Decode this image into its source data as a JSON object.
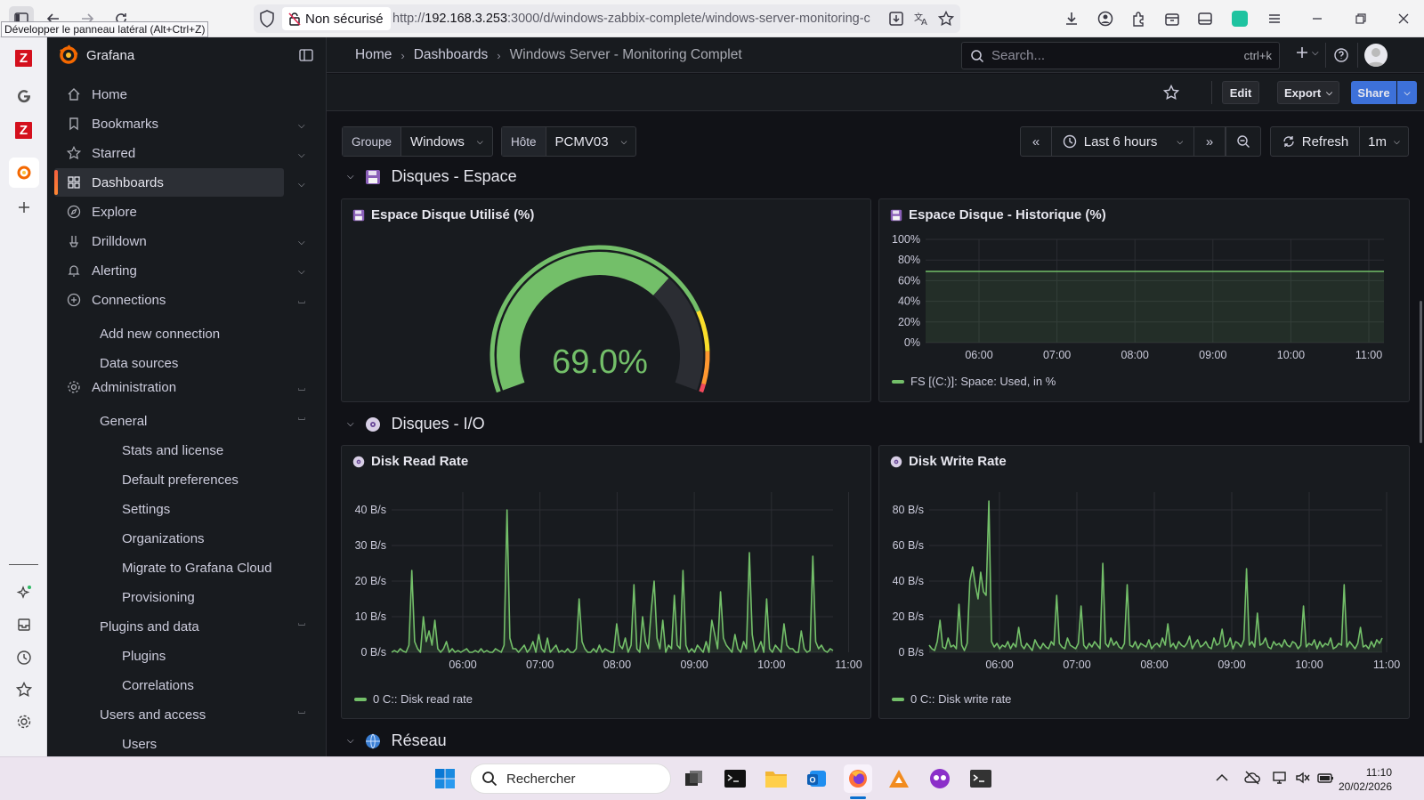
{
  "browser": {
    "tooltip": "Développer le panneau latéral (Alt+Ctrl+Z)",
    "security_label": "Non sécurisé",
    "url_prefix": "http://",
    "url_host": "192.168.3.253",
    "url_rest": ":3000/d/windows-zabbix-complete/windows-server-monitoring-c"
  },
  "appbar": {
    "items": [
      "zabbix",
      "google",
      "zabbix",
      "grafana",
      "add",
      "ai-sparkle",
      "inbox",
      "history",
      "favorites",
      "settings"
    ]
  },
  "nav": {
    "brand": "Grafana",
    "items": [
      {
        "label": "Home",
        "icon": "home-icon"
      },
      {
        "label": "Bookmarks",
        "icon": "bookmark-icon"
      },
      {
        "label": "Starred",
        "icon": "star-icon"
      },
      {
        "label": "Dashboards",
        "icon": "apps-icon"
      },
      {
        "label": "Explore",
        "icon": "compass-icon"
      },
      {
        "label": "Drilldown",
        "icon": "drilldown-icon"
      },
      {
        "label": "Alerting",
        "icon": "bell-icon"
      },
      {
        "label": "Connections",
        "icon": "link-icon"
      }
    ],
    "connections_sub": [
      "Add new connection",
      "Data sources"
    ],
    "administration": "Administration",
    "general": "General",
    "general_sub": [
      "Stats and license",
      "Default preferences",
      "Settings",
      "Organizations",
      "Migrate to Grafana Cloud",
      "Provisioning"
    ],
    "plugins_data": "Plugins and data",
    "plugins_sub": [
      "Plugins",
      "Correlations"
    ],
    "users_access": "Users and access",
    "users_sub": [
      "Users"
    ]
  },
  "topbar": {
    "crumbs": [
      "Home",
      "Dashboards",
      "Windows Server - Monitoring Complet"
    ],
    "search_placeholder": "Search...",
    "search_kbd": "ctrl+k"
  },
  "toolbar": {
    "edit": "Edit",
    "export": "Export",
    "share": "Share"
  },
  "variables": {
    "groupe_label": "Groupe",
    "groupe_value": "Windows",
    "hote_label": "Hôte",
    "hote_value": "PCMV03"
  },
  "timepicker": {
    "range": "Last 6 hours",
    "refresh": "Refresh",
    "interval": "1m"
  },
  "rows": {
    "disk_space": "Disques - Espace",
    "disk_io": "Disques - I/O",
    "network": "Réseau"
  },
  "panels": {
    "gauge_title": "Espace Disque Utilisé (%)",
    "gauge_value": "69.0%",
    "history_title": "Espace Disque - Historique (%)",
    "history_legend": "FS [(C:)]: Space: Used, in %",
    "read_title": "Disk Read Rate",
    "read_legend": "0 C:: Disk read rate",
    "write_title": "Disk Write Rate",
    "write_legend": "0 C:: Disk write rate"
  },
  "colors": {
    "green": "#73bf69",
    "yellow": "#fade2a",
    "orange": "#ff9830",
    "red": "#f2495c",
    "accent_blue": "#3d71d9"
  },
  "chart_data": [
    {
      "type": "gauge",
      "title": "Espace Disque Utilisé (%)",
      "value": 69.0,
      "unit": "%",
      "min": 0,
      "max": 100,
      "thresholds": [
        {
          "from": 0,
          "color": "#73bf69"
        },
        {
          "from": 80,
          "color": "#fade2a"
        },
        {
          "from": 90,
          "color": "#ff9830"
        },
        {
          "from": 98,
          "color": "#f2495c"
        }
      ]
    },
    {
      "type": "area",
      "title": "Espace Disque - Historique (%)",
      "yticks": [
        "0%",
        "20%",
        "40%",
        "60%",
        "80%",
        "100%"
      ],
      "ylim": [
        0,
        100
      ],
      "xticks": [
        "06:00",
        "07:00",
        "08:00",
        "09:00",
        "10:00",
        "11:00"
      ],
      "x": [
        "05:10",
        "11:10"
      ],
      "series": [
        {
          "name": "FS [(C:)]: Space: Used, in %",
          "values": [
            69,
            69
          ]
        }
      ]
    },
    {
      "type": "area",
      "title": "Disk Read Rate",
      "yticks": [
        "0 B/s",
        "10 B/s",
        "20 B/s",
        "30 B/s",
        "40 B/s"
      ],
      "ylim": [
        0,
        45
      ],
      "xticks": [
        "06:00",
        "07:00",
        "08:00",
        "09:00",
        "10:00",
        "11:00"
      ],
      "x_start": "05:10",
      "x_end": "11:10",
      "series": [
        {
          "name": "0 C:: Disk read rate",
          "values": [
            0,
            0.5,
            0,
            1,
            0.3,
            0,
            2,
            23,
            3,
            1,
            0,
            10,
            3,
            6,
            2,
            9,
            1,
            0,
            1,
            3,
            0,
            1,
            0,
            0.5,
            0,
            0.5,
            1,
            0,
            0,
            0.5,
            0,
            1,
            0,
            0.5,
            0,
            0,
            1,
            0.5,
            0,
            2,
            40,
            4,
            1,
            1,
            0,
            1,
            2,
            0,
            1,
            3,
            0,
            5,
            1,
            0,
            4,
            0,
            1,
            2,
            0,
            0.5,
            0,
            1,
            0,
            0,
            1,
            15,
            3,
            1,
            0,
            0,
            1,
            0,
            2,
            0,
            1,
            0.5,
            0,
            0,
            8,
            2,
            1,
            4,
            0,
            2,
            19,
            1,
            0,
            10,
            3,
            1,
            12,
            20,
            4,
            1,
            9,
            0,
            2,
            1,
            16,
            2,
            1,
            23,
            2,
            0,
            1,
            0,
            2,
            1,
            0,
            3,
            0,
            9,
            5,
            1,
            17,
            4,
            2,
            1,
            0,
            5,
            1,
            0,
            3,
            1,
            28,
            5,
            0,
            1,
            3,
            0,
            15,
            1,
            0,
            2,
            1,
            0,
            8,
            2,
            1,
            1,
            0,
            0,
            6,
            1,
            0,
            0.5,
            27,
            3,
            1,
            2,
            0.5,
            0,
            1,
            0.5
          ]
        }
      ]
    },
    {
      "type": "area",
      "title": "Disk Write Rate",
      "yticks": [
        "0 B/s",
        "20 B/s",
        "40 B/s",
        "60 B/s",
        "80 B/s"
      ],
      "ylim": [
        0,
        90
      ],
      "xticks": [
        "06:00",
        "07:00",
        "08:00",
        "09:00",
        "10:00",
        "11:00"
      ],
      "x_start": "05:10",
      "x_end": "11:10",
      "series": [
        {
          "name": "0 C:: Disk write rate",
          "values": [
            4,
            2,
            1,
            6,
            18,
            3,
            2,
            8,
            3,
            4,
            2,
            27,
            4,
            1,
            5,
            40,
            48,
            38,
            30,
            45,
            34,
            32,
            85,
            6,
            3,
            5,
            2,
            4,
            3,
            6,
            2,
            5,
            3,
            14,
            4,
            2,
            5,
            3,
            1,
            7,
            4,
            2,
            5,
            3,
            2,
            6,
            4,
            32,
            5,
            3,
            2,
            8,
            4,
            3,
            2,
            5,
            26,
            4,
            2,
            5,
            3,
            6,
            4,
            2,
            50,
            5,
            3,
            8,
            4,
            6,
            3,
            2,
            5,
            38,
            4,
            3,
            6,
            2,
            5,
            4,
            3,
            7,
            2,
            4,
            5,
            3,
            8,
            4,
            16,
            3,
            5,
            2,
            6,
            4,
            3,
            5,
            9,
            2,
            5,
            7,
            3,
            4,
            6,
            3,
            2,
            8,
            4,
            5,
            13,
            3,
            4,
            8,
            2,
            6,
            5,
            3,
            7,
            47,
            4,
            6,
            3,
            22,
            4,
            5,
            8,
            3,
            2,
            6,
            4,
            5,
            3,
            7,
            4,
            3,
            6,
            5,
            2,
            4,
            26,
            3,
            5,
            4,
            7,
            2,
            6,
            3,
            5,
            4,
            8,
            2,
            3,
            5,
            4,
            38,
            3,
            6,
            4,
            2,
            5,
            14,
            3,
            4,
            2,
            6,
            3,
            7,
            5,
            8
          ]
        }
      ]
    }
  ],
  "taskbar": {
    "search": "Rechercher",
    "time": "11:10",
    "date": "20/02/2026"
  }
}
